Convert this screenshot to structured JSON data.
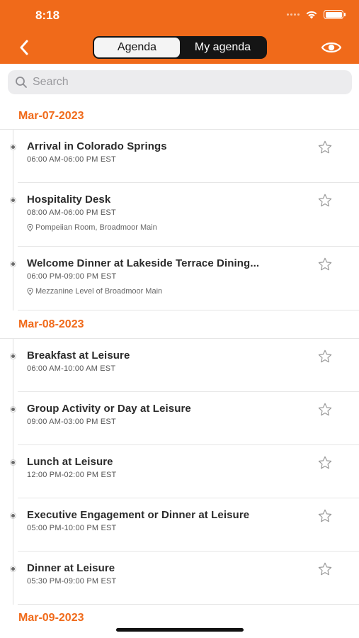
{
  "status_bar": {
    "time": "8:18"
  },
  "header": {
    "segments": [
      {
        "label": "Agenda",
        "active": true
      },
      {
        "label": "My agenda",
        "active": false
      }
    ],
    "accent_color": "#f06a1a"
  },
  "search": {
    "placeholder": "Search",
    "value": ""
  },
  "days": [
    {
      "date": "Mar-07-2023",
      "sessions": [
        {
          "title": "Arrival in Colorado Springs",
          "time": "06:00 AM-06:00 PM EST",
          "location": ""
        },
        {
          "title": "Hospitality Desk",
          "time": "08:00 AM-06:00 PM EST",
          "location": "Pompeiian Room, Broadmoor Main"
        },
        {
          "title": "Welcome Dinner at Lakeside Terrace Dining...",
          "time": "06:00 PM-09:00 PM EST",
          "location": "Mezzanine Level of Broadmoor Main"
        }
      ]
    },
    {
      "date": "Mar-08-2023",
      "sessions": [
        {
          "title": "Breakfast at Leisure",
          "time": "06:00 AM-10:00 AM EST",
          "location": ""
        },
        {
          "title": "Group Activity or Day at Leisure",
          "time": "09:00 AM-03:00 PM EST",
          "location": ""
        },
        {
          "title": "Lunch at Leisure",
          "time": "12:00 PM-02:00 PM EST",
          "location": ""
        },
        {
          "title": "Executive Engagement or Dinner at Leisure",
          "time": "05:00 PM-10:00 PM EST",
          "location": ""
        },
        {
          "title": "Dinner at Leisure",
          "time": "05:30 PM-09:00 PM EST",
          "location": ""
        }
      ]
    },
    {
      "date": "Mar-09-2023",
      "sessions": []
    }
  ]
}
